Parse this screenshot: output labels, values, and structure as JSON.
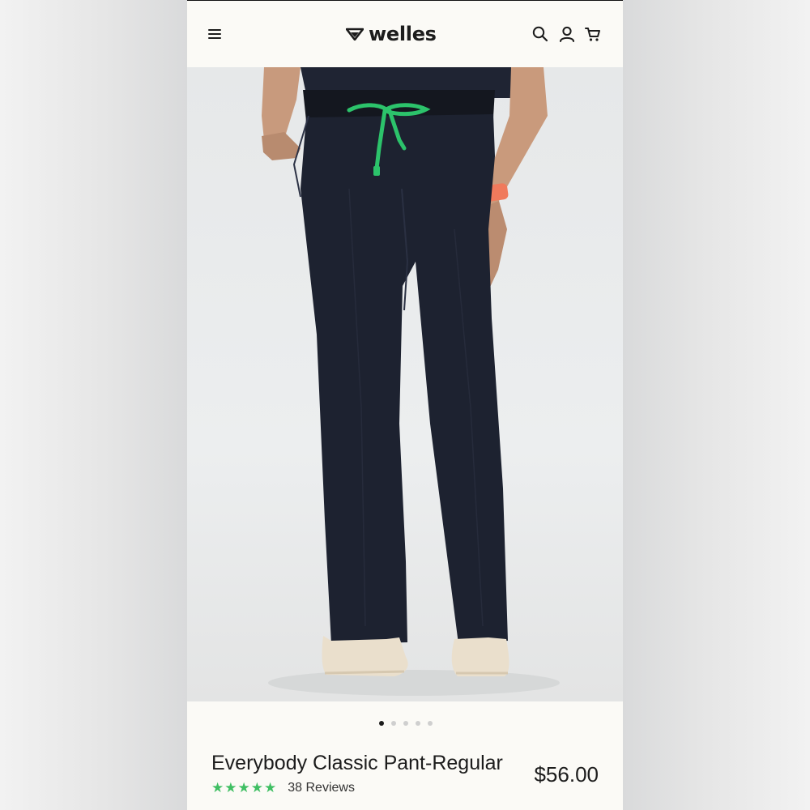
{
  "header": {
    "brand": "welles",
    "menu_icon": "hamburger-menu-icon",
    "search_icon": "search-icon",
    "account_icon": "account-icon",
    "cart_icon": "cart-icon"
  },
  "gallery": {
    "slide_count": 5,
    "active_slide": 1
  },
  "product": {
    "title": "Everybody Classic Pant-Regular",
    "price": "$56.00",
    "rating_stars": 5,
    "reviews": "38 Reviews"
  },
  "colors": {
    "accent_green": "#3fbf63",
    "pant_navy": "#1d2230",
    "drawstring_green": "#2cc36b",
    "watch_coral": "#f07a5c"
  }
}
